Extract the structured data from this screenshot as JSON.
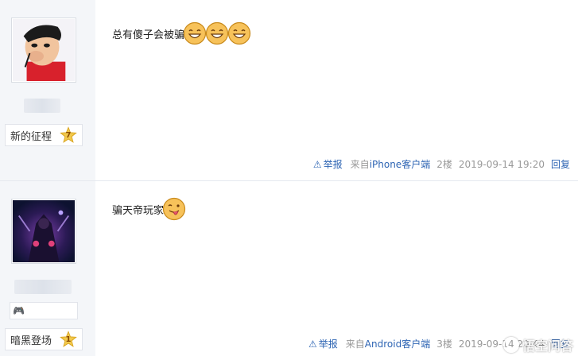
{
  "posts": [
    {
      "content": "总有傻子会被骗",
      "emoji_count": 3,
      "badge": {
        "label": "新的征程",
        "level": "7"
      },
      "meta": {
        "report": "举报",
        "client_prefix": "来自",
        "client_link": "iPhone客户端",
        "floor": "2楼",
        "time": "2019-09-14 19:20",
        "reply": "回复"
      }
    },
    {
      "content": "骗天帝玩家",
      "emoji_count": 1,
      "badge": {
        "label": "暗黑登场",
        "level": "1"
      },
      "meta": {
        "report": "举报",
        "client_prefix": "来自",
        "client_link": "Android客户端",
        "floor": "3楼",
        "time": "2019-09-14 20:44",
        "reply": "回复"
      }
    }
  ],
  "icons": {
    "report": "warning-triangle-icon",
    "emoji_laugh": "laughing-face-icon",
    "emoji_tongue": "tongue-out-face-icon",
    "level": "star-badge-icon",
    "medal": "game-controller-icon"
  },
  "colors": {
    "link": "#2d64b3",
    "meta_gray": "#999999",
    "sidebar_bg": "#f4f6f9",
    "star": "#f2c94c"
  },
  "watermark": {
    "text": "悟空问答"
  }
}
